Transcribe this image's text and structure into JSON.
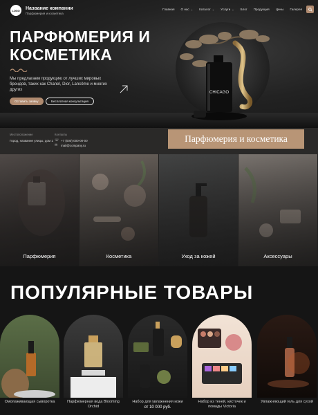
{
  "header": {
    "logo_mark": "LOGO",
    "company_name": "Название компании",
    "company_sub": "Парфюмерия и косметика",
    "nav": [
      "Главная",
      "О нас",
      "Каталог",
      "Услуги",
      "Блог",
      "Продукция",
      "Цены",
      "Галерея"
    ],
    "nav_button_icon": "search-icon"
  },
  "hero": {
    "title_line1": "ПАРФЮМЕРИЯ И",
    "title_line2": "КОСМЕТИКА",
    "description": "Мы предлагаем продукцию от лучших мировых брендов, таких как Chanel, Dior, Lancôme и многих других",
    "primary_button": "Оставить заявку",
    "secondary_button": "Бесплатная консультация",
    "bottle_label": "CHICAGO"
  },
  "contacts": {
    "address_label": "Местоположение",
    "address_value": "Город, название улицы, дом 1",
    "contacts_label": "Контакты",
    "phone": "+7 (000) 000-00-00",
    "email": "mail@company.ru"
  },
  "banner": {
    "text": "Парфюмерия и косметика"
  },
  "categories": [
    {
      "label": "Парфюмерия"
    },
    {
      "label": "Косметика"
    },
    {
      "label": "Уход за кожей"
    },
    {
      "label": "Аксессуары"
    }
  ],
  "popular": {
    "title": "ПОПУЛЯРНЫЕ ТОВАРЫ",
    "products": [
      {
        "name": "Омолаживающая сыворотка",
        "price": ""
      },
      {
        "name": "Парфюмерная вода Blooming Orchid",
        "price": ""
      },
      {
        "name": "Набор для увлажнения кожи",
        "price": "от 10 000 руб."
      },
      {
        "name": "Набор из теней, кисточек и помады Victoria",
        "price": ""
      },
      {
        "name": "Увлажняющий гель для сухой",
        "price": ""
      }
    ]
  },
  "colors": {
    "accent": "#b08b70",
    "banner": "#b89576",
    "background": "#151515",
    "strip": "#2a2928"
  }
}
